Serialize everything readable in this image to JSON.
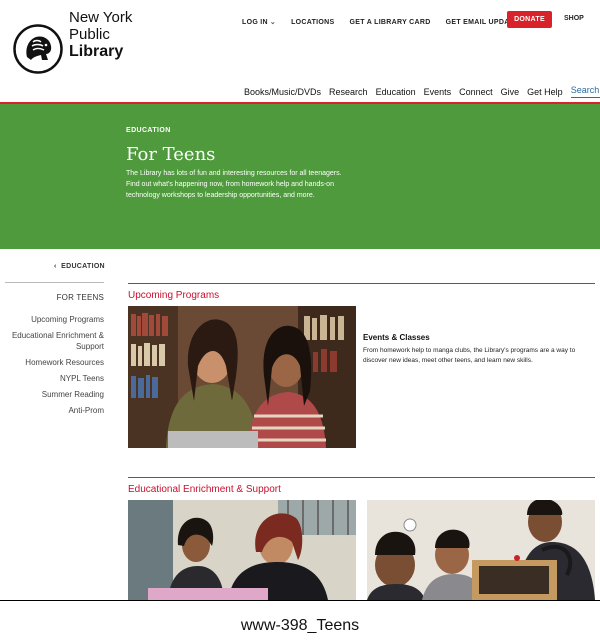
{
  "brand": {
    "line1": "New York",
    "line2": "Public",
    "line3": "Library"
  },
  "topnav": {
    "login": "LOG IN",
    "locations": "LOCATIONS",
    "library_card": "GET A LIBRARY CARD",
    "email_updates": "GET EMAIL UPDATES",
    "donate": "DONATE",
    "shop": "SHOP"
  },
  "mainnav": {
    "items": [
      "Books/Music/DVDs",
      "Research",
      "Education",
      "Events",
      "Connect",
      "Give",
      "Get Help"
    ],
    "search": "Search"
  },
  "hero": {
    "kicker": "EDUCATION",
    "title": "For Teens",
    "description": "The Library has lots of fun and interesting resources for all teenagers. Find out what's happening now, from homework help and hands-on technology workshops to leadership opportunities, and more."
  },
  "sidebar": {
    "back": "EDUCATION",
    "current": "FOR TEENS",
    "items": [
      "Upcoming Programs",
      "Educational Enrichment & Support",
      "Homework Resources",
      "NYPL Teens",
      "Summer Reading",
      "Anti-Prom"
    ]
  },
  "sections": {
    "upcoming": {
      "title": "Upcoming Programs",
      "card_title": "Events & Classes",
      "card_desc": "From homework help to manga clubs, the Library's programs are a way to discover new ideas, meet other teens, and learn new skills."
    },
    "enrichment": {
      "title": "Educational Enrichment & Support"
    }
  },
  "caption": "www-398_Teens",
  "colors": {
    "accent_red": "#d8232a",
    "hero_green": "#4f9a3c",
    "link_blue": "#2e6b9e"
  }
}
